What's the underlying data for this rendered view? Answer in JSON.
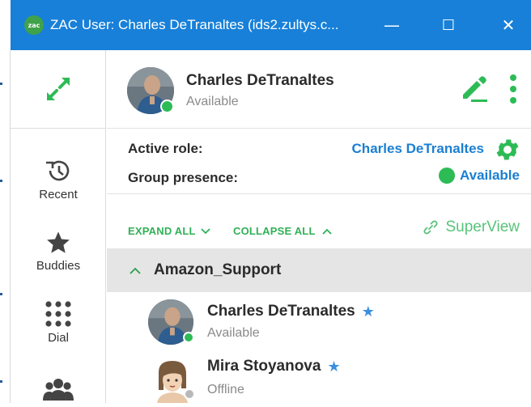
{
  "window": {
    "title": "ZAC User: Charles DeTranaltes (ids2.zultys.c...",
    "logo_text": "zac",
    "controls": {
      "minimize": "—",
      "maximize": "☐",
      "close": "✕"
    }
  },
  "sidebar": {
    "expand_icon": "expand-arrows-icon",
    "items": [
      {
        "label": "Recent",
        "icon": "history-clock-icon"
      },
      {
        "label": "Buddies",
        "icon": "star-icon"
      },
      {
        "label": "Dial",
        "icon": "dialpad-icon"
      },
      {
        "label": "",
        "icon": "group-people-icon"
      }
    ]
  },
  "profile": {
    "name": "Charles DeTranaltes",
    "status": "Available",
    "status_color": "#2dbb55",
    "edit_icon": "pencil-icon",
    "menu_icon": "kebab-menu-icon"
  },
  "roles": {
    "active_role_label": "Active role:",
    "active_role_value": "Charles DeTranaltes",
    "settings_icon": "gear-icon",
    "group_presence_label": "Group presence:",
    "group_presence_value": "Available"
  },
  "controls": {
    "expand_all": "EXPAND ALL",
    "collapse_all": "COLLAPSE ALL",
    "superview": "SuperView"
  },
  "group": {
    "name": "Amazon_Support",
    "members": [
      {
        "name": "Charles DeTranaltes",
        "status": "Available",
        "status_color": "#2dbb55",
        "favorite": true
      },
      {
        "name": "Mira Stoyanova",
        "status": "Offline",
        "status_color": "#b9b9b9",
        "favorite": true
      }
    ]
  },
  "colors": {
    "titlebar": "#1880d8",
    "accent_green": "#2dbb55",
    "link_blue": "#1a7fd2",
    "group_header_bg": "#e5e5e5"
  }
}
